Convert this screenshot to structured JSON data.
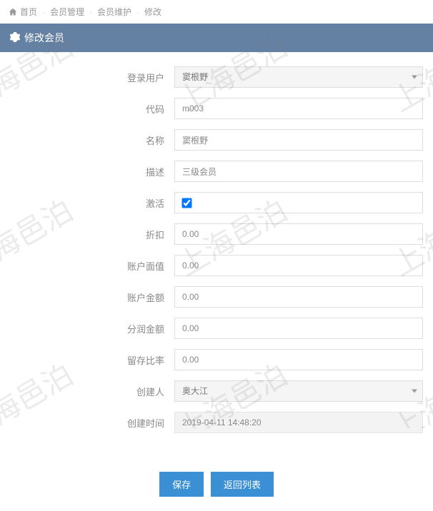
{
  "watermark_text": "上海邑泊",
  "breadcrumb": {
    "home": "首页",
    "lvl1": "会员管理",
    "lvl2": "会员维护",
    "current": "修改"
  },
  "panel": {
    "title": "修改会员"
  },
  "form": {
    "login_user": {
      "label": "登录用户",
      "value": "窦根野"
    },
    "code": {
      "label": "代码",
      "value": "m003"
    },
    "name": {
      "label": "名称",
      "value": "窦根野"
    },
    "description": {
      "label": "描述",
      "value": "三级会员"
    },
    "active": {
      "label": "激活",
      "checked": true
    },
    "discount": {
      "label": "折扣",
      "value": "0.00"
    },
    "face_value": {
      "label": "账户面值",
      "value": "0.00"
    },
    "account_amount": {
      "label": "账户金额",
      "value": "0.00"
    },
    "dividend_amount": {
      "label": "分润金额",
      "value": "0.00"
    },
    "retention_ratio": {
      "label": "留存比率",
      "value": "0.00"
    },
    "creator": {
      "label": "创建人",
      "value": "奥大江"
    },
    "created_time": {
      "label": "创建时间",
      "value": "2019-04-11 14:48:20"
    }
  },
  "actions": {
    "save": "保存",
    "back": "返回列表"
  }
}
